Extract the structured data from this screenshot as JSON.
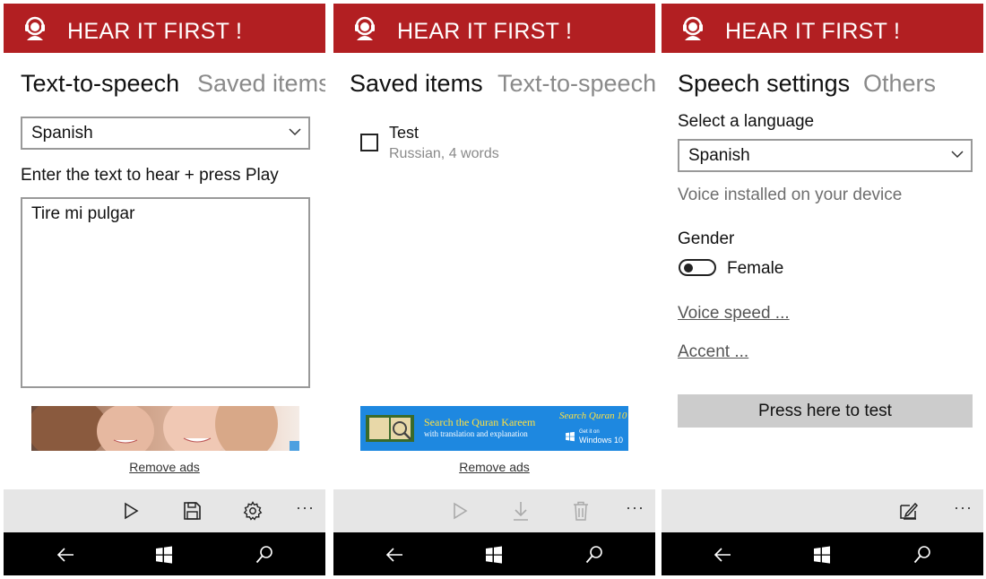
{
  "app": {
    "title": "HEAR IT FIRST !"
  },
  "screen1": {
    "pivot_active": "Text-to-speech",
    "pivot_inactive": "Saved items",
    "language_value": "Spanish",
    "prompt": "Enter the text to hear + press Play",
    "text_value": "Tire mi pulgar",
    "remove_ads": "Remove ads",
    "appbar": {
      "icons": [
        "play-icon",
        "save-icon",
        "settings-icon"
      ],
      "more": "···"
    }
  },
  "screen2": {
    "pivot_active": "Saved items",
    "pivot_inactive": "Text-to-speech",
    "items": [
      {
        "title": "Test",
        "subtitle": "Russian, 4 words"
      }
    ],
    "ad": {
      "line1": "Search the Quran Kareem",
      "line2": "with translation and explanation",
      "brand": "Search Quran 10",
      "get_it_on": "Get it on",
      "windows": "Windows 10"
    },
    "remove_ads": "Remove ads",
    "appbar": {
      "icons": [
        "play-icon",
        "download-icon",
        "delete-icon"
      ],
      "more": "···"
    }
  },
  "screen3": {
    "pivot_active": "Speech settings",
    "pivot_inactive": "Others",
    "language_label": "Select a language",
    "language_value": "Spanish",
    "voice_status": "Voice installed on your device",
    "gender_label": "Gender",
    "gender_value": "Female",
    "gender_toggle_on": false,
    "voice_speed": "Voice speed ...",
    "accent": "Accent ...",
    "test_button": "Press here to test",
    "appbar": {
      "icons": [
        "edit-icon"
      ],
      "more": "···"
    }
  },
  "colors": {
    "titlebar": "#b21f22",
    "appbar": "#e6e6e6",
    "navbar": "#000000",
    "ad_blue": "#1e88e0",
    "test_button": "#cccccc"
  }
}
